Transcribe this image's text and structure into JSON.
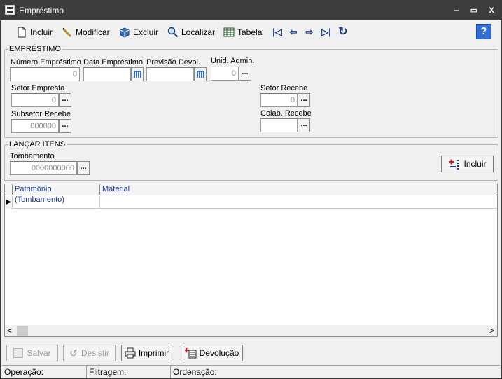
{
  "window": {
    "title": "Empréstimo",
    "minimize": "‒",
    "maximize": "▭",
    "close": "X"
  },
  "toolbar": {
    "incluir": "Incluir",
    "modificar": "Modificar",
    "excluir": "Excluir",
    "localizar": "Localizar",
    "tabela": "Tabela",
    "help": "?"
  },
  "emprestimo": {
    "legend": "EMPRÉSTIMO",
    "numero_label": "Número Empréstimo",
    "numero_value": "0",
    "data_label": "Data Empréstimo",
    "data_value": "",
    "previsao_label": "Previsão Devol.",
    "previsao_value": "",
    "unid_label": "Unid. Admin.",
    "unid_value": "0",
    "setor_empresta_label": "Setor Empresta",
    "setor_empresta_value": "0",
    "setor_recebe_label": "Setor Recebe",
    "setor_recebe_value": "0",
    "subsetor_label": "Subsetor Recebe",
    "subsetor_value": "000000",
    "colab_label": "Colab. Recebe",
    "colab_value": "",
    "dots": "..."
  },
  "itens": {
    "legend": "LANÇAR ITENS",
    "tombamento_label": "Tombamento",
    "tombamento_value": "0000000000",
    "incluir": "Incluir"
  },
  "grid": {
    "columns": [
      "Patrimônio (Tombamento)",
      "Material"
    ],
    "row_indicator": "▶",
    "scroll_left": "<",
    "scroll_right": ">"
  },
  "buttons": {
    "salvar": "Salvar",
    "desistir": "Desistir",
    "imprimir": "Imprimir",
    "devolucao": "Devolução"
  },
  "status": {
    "operacao": "Operação:",
    "filtragem": "Filtragem:",
    "ordenacao": "Ordenação:"
  }
}
